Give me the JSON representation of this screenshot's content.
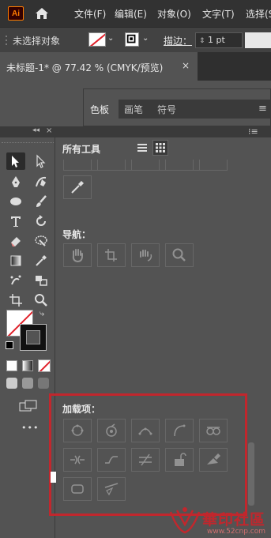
{
  "app": {
    "logo": "Ai",
    "accent": "#ff7c00"
  },
  "menubar": {
    "items": [
      "文件(F)",
      "编辑(E)",
      "对象(O)",
      "文字(T)",
      "选择(S"
    ]
  },
  "controlbar": {
    "selection_status": "未选择对象",
    "stroke_label": "描边：",
    "stroke_weight": "1 pt"
  },
  "document_tab": {
    "title": "未标题-1* @ 77.42 % (CMYK/预览)",
    "close": "×"
  },
  "swatches_panel": {
    "tabs": [
      "色板",
      "画笔",
      "符号"
    ]
  },
  "tools_panel": {
    "collapse": "◂◂",
    "close": "×",
    "more": "•••"
  },
  "all_tools": {
    "title": "所有工具",
    "navigation_label": "导航：",
    "addons_label": "加载项：",
    "highlight_color": "#c1272d"
  },
  "watermark": {
    "text": "華印社區",
    "url": "www.52cnp.com"
  }
}
